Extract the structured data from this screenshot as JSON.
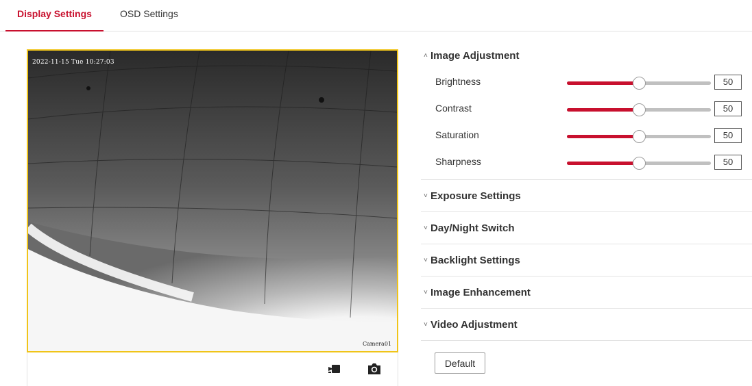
{
  "tabs": [
    {
      "label": "Display Settings",
      "active": true
    },
    {
      "label": "OSD Settings",
      "active": false
    }
  ],
  "preview": {
    "timestamp": "2022-11-15 Tue 10:27:03",
    "camera_name": "Camera01",
    "border_color": "#f0c419"
  },
  "toolbar": {
    "record_icon": "video-record-icon",
    "snapshot_icon": "camera-snapshot-icon"
  },
  "image_adjustment": {
    "title": "Image Adjustment",
    "expanded": true,
    "sliders": [
      {
        "label": "Brightness",
        "value": "50",
        "level": 0.5
      },
      {
        "label": "Contrast",
        "value": "50",
        "level": 0.5
      },
      {
        "label": "Saturation",
        "value": "50",
        "level": 0.5
      },
      {
        "label": "Sharpness",
        "value": "50",
        "level": 0.5
      }
    ]
  },
  "sections": [
    {
      "title": "Exposure Settings",
      "expanded": false
    },
    {
      "title": "Day/Night Switch",
      "expanded": false
    },
    {
      "title": "Backlight Settings",
      "expanded": false
    },
    {
      "title": "Image Enhancement",
      "expanded": false
    },
    {
      "title": "Video Adjustment",
      "expanded": false
    }
  ],
  "default_button": "Default",
  "colors": {
    "accent": "#c8102e",
    "track": "#c0c0c0"
  }
}
